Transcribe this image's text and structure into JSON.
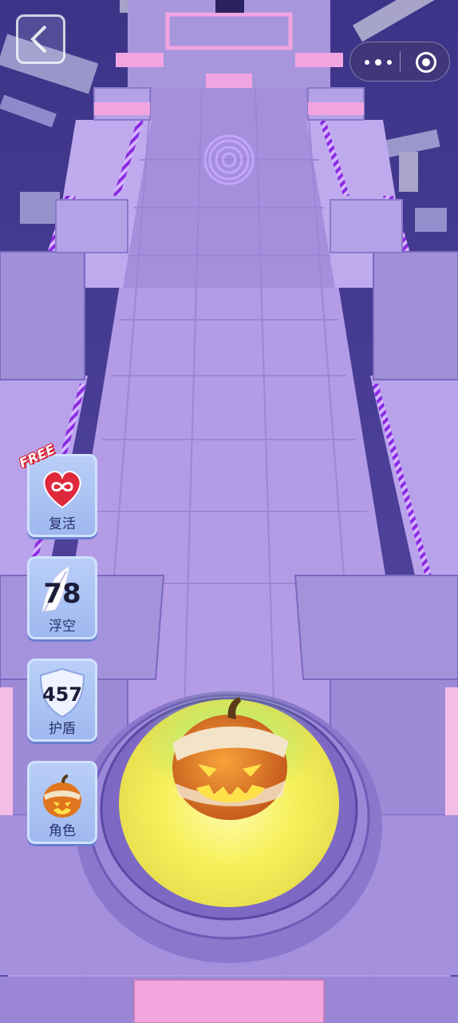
{
  "powerups": [
    {
      "tag": "FREE",
      "icon": "infinity-heart-icon",
      "label": "复活"
    },
    {
      "count": "78",
      "icon": "feather-icon",
      "label": "浮空"
    },
    {
      "count": "457",
      "icon": "shield-icon",
      "label": "护盾"
    },
    {
      "icon": "pumpkin-icon",
      "label": "角色"
    }
  ],
  "colors": {
    "track": "#b39be6",
    "tile_pink": "#f2a8dc",
    "accent_purple": "#8a2be2",
    "ball_glow": "#f6f260"
  }
}
